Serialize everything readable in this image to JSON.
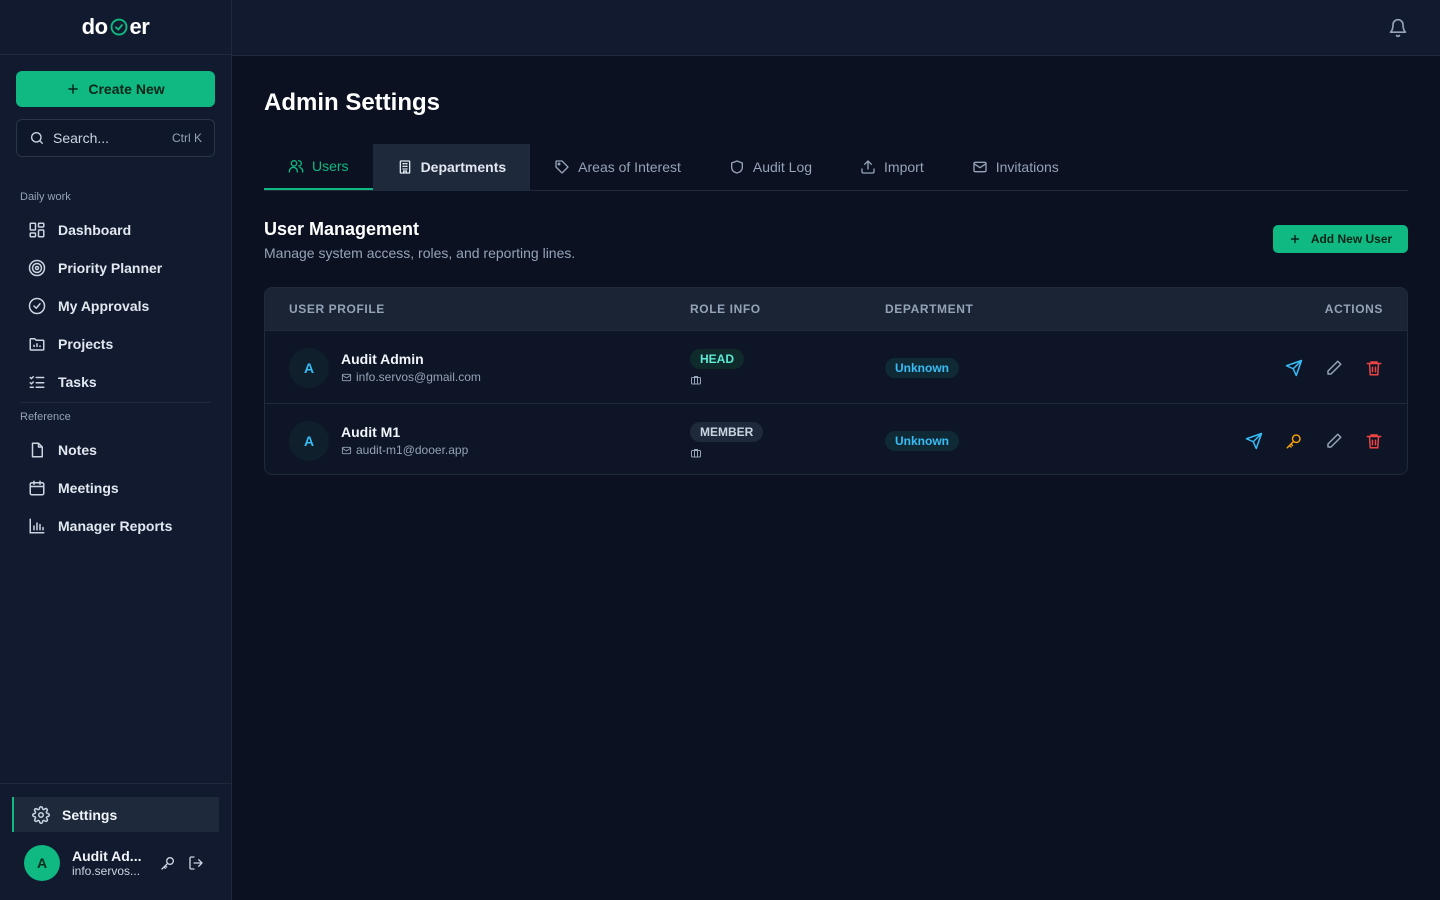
{
  "app": {
    "logo_left": "do",
    "logo_right": "er"
  },
  "sidebar": {
    "create_label": "Create New",
    "search_placeholder": "Search...",
    "search_shortcut": "Ctrl K",
    "sections": [
      {
        "label": "Daily work",
        "items": [
          "Dashboard",
          "Priority Planner",
          "My Approvals",
          "Projects",
          "Tasks"
        ]
      },
      {
        "label": "Reference",
        "items": [
          "Notes",
          "Meetings",
          "Manager Reports"
        ]
      }
    ],
    "settings_label": "Settings",
    "user": {
      "initial": "A",
      "name": "Audit Ad...",
      "email": "info.servos..."
    }
  },
  "page": {
    "title": "Admin Settings",
    "tabs": [
      "Users",
      "Departments",
      "Areas of Interest",
      "Audit Log",
      "Import",
      "Invitations"
    ],
    "section_title": "User Management",
    "section_subtitle": "Manage system access, roles, and reporting lines.",
    "add_user_label": "Add New User"
  },
  "table": {
    "headers": [
      "USER PROFILE",
      "ROLE INFO",
      "DEPARTMENT",
      "ACTIONS"
    ],
    "rows": [
      {
        "initial": "A",
        "name": "Audit Admin",
        "email": "info.servos@gmail.com",
        "role": "HEAD",
        "department": "Unknown"
      },
      {
        "initial": "A",
        "name": "Audit M1",
        "email": "audit-m1@dooer.app",
        "role": "MEMBER",
        "department": "Unknown"
      }
    ]
  },
  "colors": {
    "accent": "#10b981",
    "background": "#0b1120",
    "sidebar": "#111a2e"
  }
}
